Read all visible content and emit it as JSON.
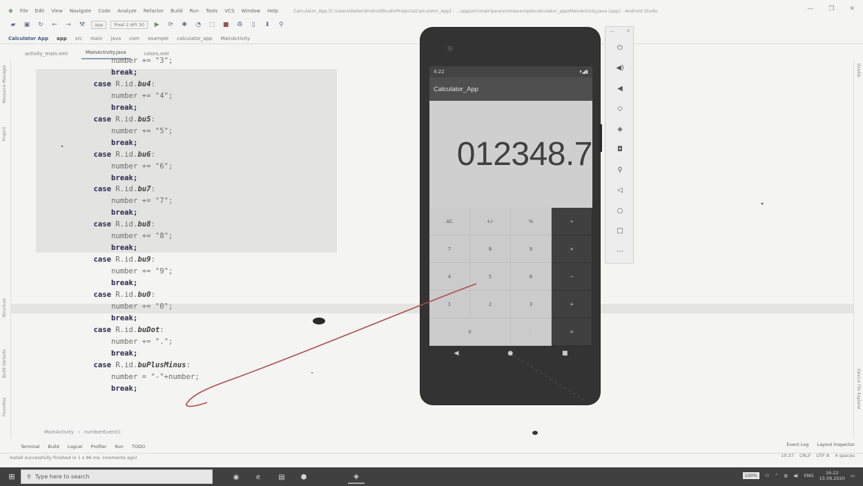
{
  "ide": {
    "menus": [
      "File",
      "Edit",
      "View",
      "Navigate",
      "Code",
      "Analyze",
      "Refactor",
      "Build",
      "Run",
      "Tools",
      "VCS",
      "Window",
      "Help"
    ],
    "window_title": "Calculator_App [C:\\Users\\Keller\\AndroidStudioProjects\\Calculator_App] - ...\\app\\src\\main\\java\\com\\example\\calculator_app\\MainActivity.java [app] - Android Studio",
    "toolbar": {
      "config_combo": "app",
      "device_combo": "Pixel 2 API 30"
    },
    "nav": [
      "Calculator App",
      "app",
      "src",
      "main",
      "java",
      "com",
      "example",
      "calculator_app",
      "MainActivity"
    ],
    "tabs": [
      {
        "label": "activity_main.xml",
        "active": false
      },
      {
        "label": "MainActivity.java",
        "active": true
      },
      {
        "label": "colors.xml",
        "active": false
      }
    ],
    "left_tools": [
      "Resource Manager",
      "Project",
      "Structure",
      "Build Variants",
      "Favorites"
    ],
    "right_tools": [
      "Gradle",
      "Device File Explorer"
    ],
    "breadcrumb": [
      "MainActivity",
      "numberEvent()"
    ],
    "bottom_tools_left": [
      "Terminal",
      "Build",
      "Logcat",
      "Profiler",
      "Run",
      "TODO"
    ],
    "bottom_tools_right": [
      "Event Log",
      "Layout Inspector"
    ],
    "status_text": "Install successfully finished in 1 s 96 ms. (moments ago)",
    "status_right": [
      "10:37",
      "CRLF",
      "UTF-8",
      "4 spaces"
    ]
  },
  "code_lines": [
    {
      "indent": 2,
      "kind": "stmt",
      "text": "number += \"3\";"
    },
    {
      "indent": 2,
      "kind": "break",
      "text": "break;"
    },
    {
      "indent": 1,
      "kind": "case",
      "kw": "case",
      "id": "R.id.",
      "name": "bu4",
      "tail": ":"
    },
    {
      "indent": 2,
      "kind": "stmt",
      "text": "number += \"4\";"
    },
    {
      "indent": 2,
      "kind": "break",
      "text": "break;"
    },
    {
      "indent": 1,
      "kind": "case",
      "kw": "case",
      "id": "R.id.",
      "name": "bu5",
      "tail": ":"
    },
    {
      "indent": 2,
      "kind": "stmt",
      "text": "number += \"5\";"
    },
    {
      "indent": 2,
      "kind": "break",
      "text": "break;"
    },
    {
      "indent": 1,
      "kind": "case",
      "kw": "case",
      "id": "R.id.",
      "name": "bu6",
      "tail": ":"
    },
    {
      "indent": 2,
      "kind": "stmt",
      "text": "number += \"6\";"
    },
    {
      "indent": 2,
      "kind": "break",
      "text": "break;"
    },
    {
      "indent": 1,
      "kind": "case",
      "kw": "case",
      "id": "R.id.",
      "name": "bu7",
      "tail": ":"
    },
    {
      "indent": 2,
      "kind": "stmt",
      "text": "number += \"7\";"
    },
    {
      "indent": 2,
      "kind": "break",
      "text": "break;"
    },
    {
      "indent": 1,
      "kind": "case",
      "kw": "case",
      "id": "R.id.",
      "name": "bu8",
      "tail": ":"
    },
    {
      "indent": 2,
      "kind": "stmt",
      "text": "number += \"8\";"
    },
    {
      "indent": 2,
      "kind": "break",
      "text": "break;"
    },
    {
      "indent": 1,
      "kind": "case",
      "kw": "case",
      "id": "R.id.",
      "name": "bu9",
      "tail": ":"
    },
    {
      "indent": 2,
      "kind": "stmt",
      "text": "number += \"9\";"
    },
    {
      "indent": 2,
      "kind": "break",
      "text": "break;"
    },
    {
      "indent": 1,
      "kind": "case",
      "kw": "case",
      "id": "R.id.",
      "name": "bu0",
      "tail": ":"
    },
    {
      "indent": 2,
      "kind": "stmt",
      "text": "number += \"0\";"
    },
    {
      "indent": 2,
      "kind": "break",
      "text": "break;"
    },
    {
      "indent": 1,
      "kind": "case",
      "kw": "case",
      "id": "R.id.",
      "name": "buDot",
      "tail": ":"
    },
    {
      "indent": 2,
      "kind": "stmt",
      "text": "number += \".\";"
    },
    {
      "indent": 2,
      "kind": "break",
      "text": "break;"
    },
    {
      "indent": 1,
      "kind": "case",
      "kw": "case",
      "id": "R.id.",
      "name": "buPlusMinus",
      "tail": ":"
    },
    {
      "indent": 2,
      "kind": "stmt",
      "text": "number = \"-\"+number;"
    },
    {
      "indent": 2,
      "kind": "break",
      "text": "break;"
    }
  ],
  "emulator": {
    "status_time": "4:22",
    "app_title": "Calculator_App",
    "display_value": "012348.7",
    "keypad": [
      [
        "AC",
        "+/-",
        "%",
        "÷"
      ],
      [
        "7",
        "8",
        "9",
        "×"
      ],
      [
        "4",
        "5",
        "6",
        "−"
      ],
      [
        "1",
        "2",
        "3",
        "+"
      ],
      [
        "0",
        ".",
        "="
      ]
    ]
  },
  "emulator_tools": [
    "power-icon",
    "volume-up-icon",
    "volume-down-icon",
    "rotate-left-icon",
    "rotate-right-icon",
    "camera-icon",
    "zoom-icon",
    "back-icon",
    "home-icon",
    "overview-icon",
    "more-icon"
  ],
  "taskbar": {
    "search_placeholder": "Type here to search",
    "zoom_badge": "100%",
    "language": "ENG",
    "time": "16:22",
    "date": "15.09.2020"
  },
  "colors": {
    "keyword": "#202060",
    "operator_key": "#3a3a3a",
    "pen_annotation": "#e03a3a",
    "taskbar": "#3a3a3c"
  }
}
